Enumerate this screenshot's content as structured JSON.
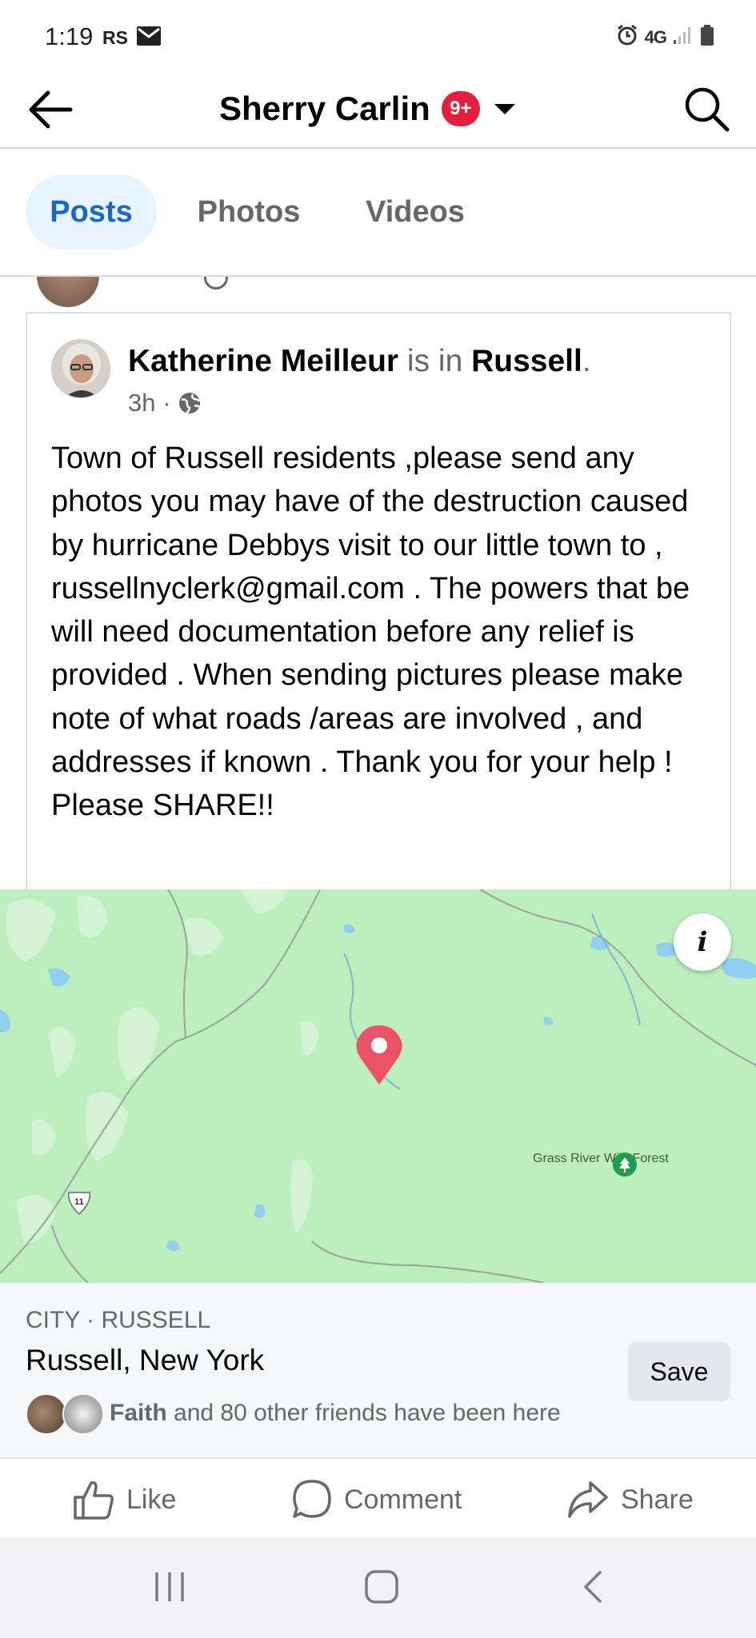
{
  "status_bar": {
    "time": "1:19",
    "carrier": "RS",
    "network": "4G",
    "icons": [
      "mail-icon",
      "alarm-icon",
      "signal-icon",
      "battery-icon"
    ]
  },
  "header": {
    "title": "Sherry Carlin",
    "badge": "9+",
    "badge_color": "#e41e3f",
    "icons": [
      "back-arrow-icon",
      "chevron-down-icon",
      "search-icon"
    ]
  },
  "tabs": [
    {
      "label": "Posts",
      "active": true
    },
    {
      "label": "Photos",
      "active": false
    },
    {
      "label": "Videos",
      "active": false
    }
  ],
  "post": {
    "author": "Katherine Meilleur",
    "is_in": " is in ",
    "place": "Russell",
    "period": ".",
    "time": "3h ·",
    "audience_icon": "globe-icon",
    "body": "Town of Russell residents ,please send any photos you may have of the destruction caused by hurricane Debbys visit to our little town to , russellnyclerk@gmail.com . The powers that be will need documentation before any relief is provided . When sending pictures please make note of what roads /areas are involved , and addresses if known . Thank you for your help ! Please SHARE!!"
  },
  "map": {
    "info_button": "i",
    "poi_label": "Grass River Wild Forest",
    "route_number": "11",
    "pin_color": "#ec5267",
    "land_color": "#bdeebd"
  },
  "location": {
    "category": "CITY · RUSSELL",
    "name": "Russell, New York",
    "friend_name": "Faith",
    "friends_text": " and 80 other friends have been here",
    "save_label": "Save"
  },
  "actions": {
    "like": "Like",
    "comment": "Comment",
    "share": "Share"
  },
  "accent_color": "#1b66c9"
}
